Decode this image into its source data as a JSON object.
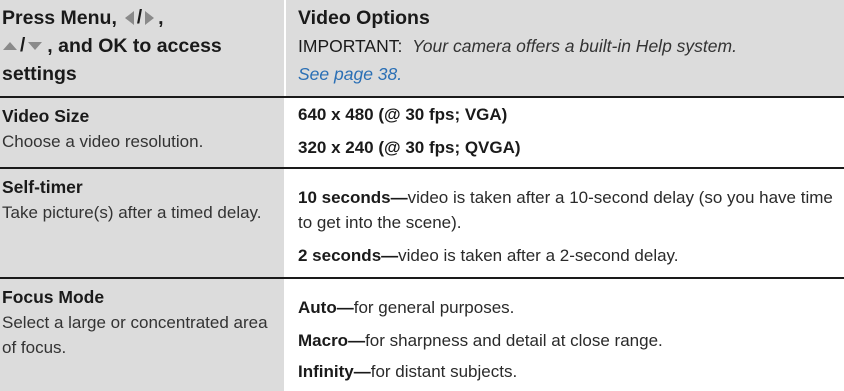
{
  "header": {
    "left_line1_prefix": "Press Menu,",
    "left_line1_suffix": ",",
    "left_line2_suffix": ", and OK to access",
    "left_line3": "settings",
    "title": "Video Options",
    "important_label": "IMPORTANT:",
    "important_text": "Your camera offers a built-in Help system.",
    "link_text": "See page 38."
  },
  "icons": {
    "left_right": "left-right-arrow-icons",
    "up_down": "up-down-arrow-icons"
  },
  "colors": {
    "shade": "#dcdcdc",
    "link": "#2a6fb5",
    "rule": "#1a1a1a"
  },
  "rows": [
    {
      "setting": "Video Size",
      "desc": "Choose a video resolution.",
      "options": [
        {
          "bold": "640 x 480 (@ 30 fps; VGA)",
          "text": ""
        },
        {
          "bold": "320 x 240 (@ 30 fps; QVGA)",
          "text": ""
        }
      ]
    },
    {
      "setting": "Self-timer",
      "desc": "Take picture(s) after a timed delay.",
      "options": [
        {
          "bold": "10 seconds—",
          "text": "video is taken after a 10-second delay (so you have time to get into the scene)."
        },
        {
          "bold": "2 seconds—",
          "text": "video is taken after a 2-second delay."
        }
      ]
    },
    {
      "setting": "Focus Mode",
      "desc": "Select a large or concentrated area of focus.",
      "options": [
        {
          "bold": "Auto—",
          "text": "for general purposes."
        },
        {
          "bold": "Macro—",
          "text": "for sharpness and detail at close range."
        },
        {
          "bold": "Infinity—",
          "text": "for distant subjects."
        }
      ]
    }
  ]
}
